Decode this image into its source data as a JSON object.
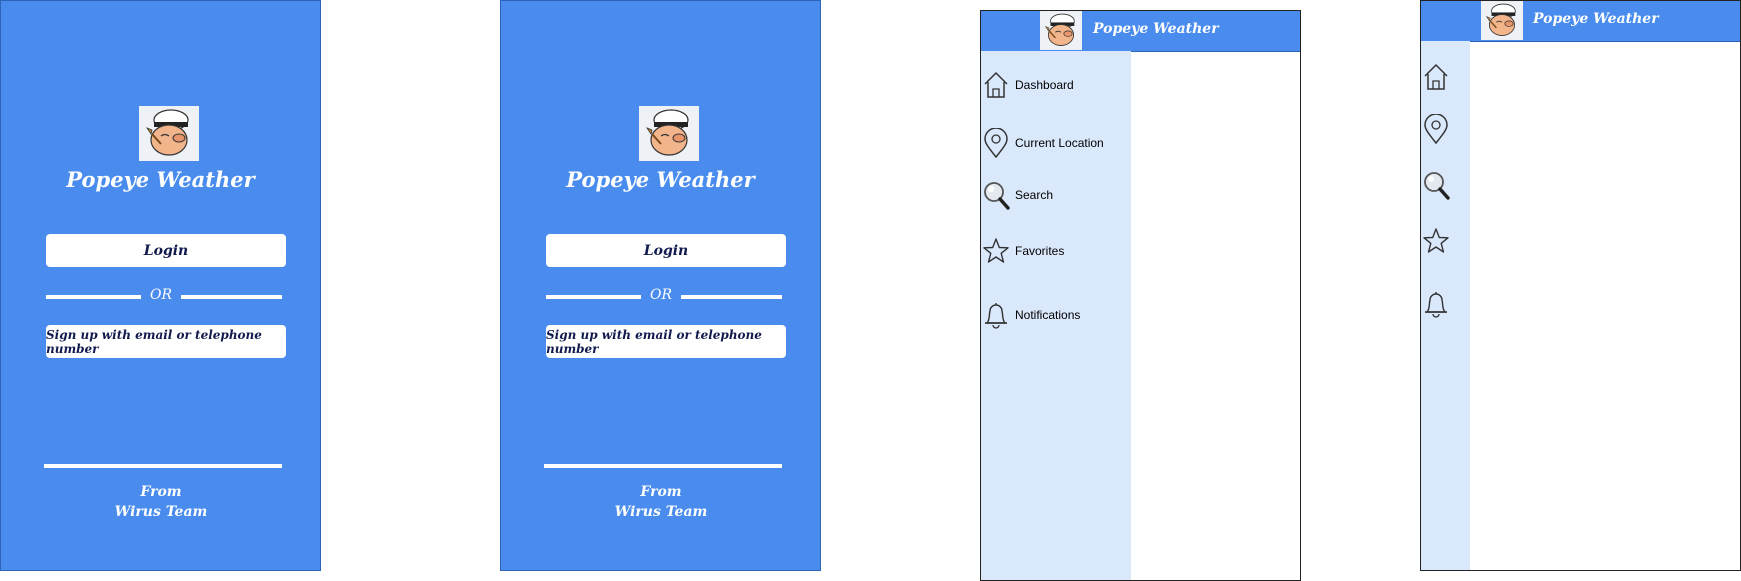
{
  "app": {
    "title": "Popeye Weather"
  },
  "login_screen": {
    "login_label": "Login",
    "or_label": "OR",
    "signup_label": "Sign up with email or telephone number",
    "footer_line1": "From",
    "footer_line2": "Wirus Team"
  },
  "nav": {
    "items": [
      {
        "label": "Dashboard",
        "icon": "home-icon"
      },
      {
        "label": "Current Location",
        "icon": "location-pin-icon"
      },
      {
        "label": "Search",
        "icon": "magnifier-icon"
      },
      {
        "label": "Favorites",
        "icon": "star-icon"
      },
      {
        "label": "Notifications",
        "icon": "bell-icon"
      }
    ]
  },
  "colors": {
    "primary": "#4a8ced",
    "sidebar": "#dae8fc",
    "button_text": "#111a4d"
  }
}
